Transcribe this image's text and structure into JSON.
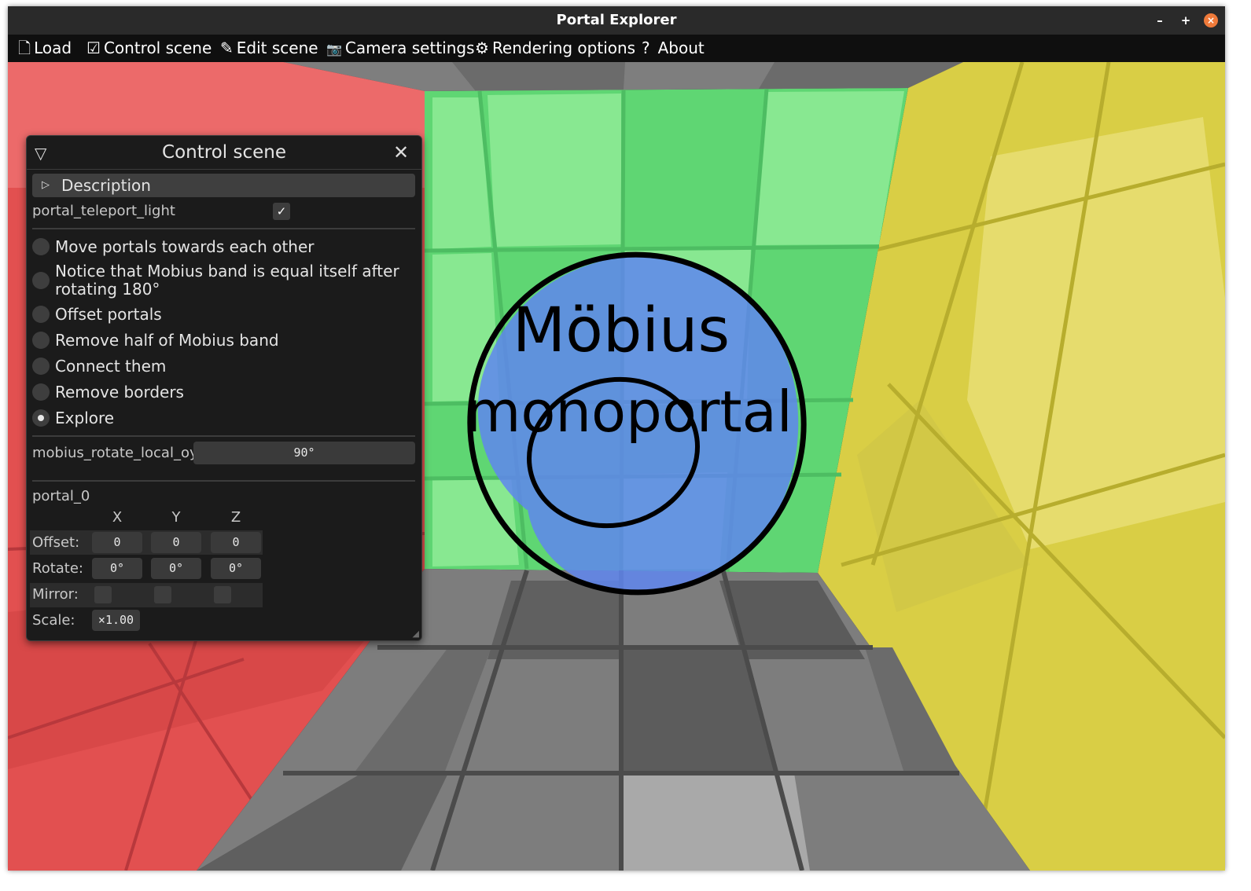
{
  "window": {
    "title": "Portal Explorer",
    "controls": {
      "minimize": "–",
      "maximize": "+",
      "close": "×"
    }
  },
  "menu": {
    "items": [
      {
        "icon": "file-icon",
        "glyph": "🗋",
        "label": "Load"
      },
      {
        "icon": "checkbox-icon",
        "glyph": "☑",
        "label": "Control scene"
      },
      {
        "icon": "pencil-icon",
        "glyph": "✎",
        "label": "Edit scene"
      },
      {
        "icon": "camera-icon",
        "glyph": "📷",
        "label": "Camera settings"
      },
      {
        "icon": "gear-icon",
        "glyph": "⚙",
        "label": "Rendering options"
      },
      {
        "icon": "question-icon",
        "glyph": "?",
        "label": "About"
      }
    ]
  },
  "scene": {
    "overlay_line1": "Möbius",
    "overlay_line2": "monoportal",
    "colors": {
      "red": "#e24a4a",
      "green": "#6fdc7e",
      "yellow": "#d6cd46",
      "grey": "#7a7a7a",
      "portal_blue": "#5f86ee"
    }
  },
  "panel": {
    "collapse_glyph": "▽",
    "title": "Control scene",
    "close_glyph": "✕",
    "description": {
      "glyph": "▷",
      "label": "Description"
    },
    "teleport_light": {
      "label": "portal_teleport_light",
      "checked": true,
      "check_glyph": "✓"
    },
    "steps": [
      {
        "lines": [
          "Move portals towards each other"
        ],
        "selected": false
      },
      {
        "lines": [
          "Notice that Mobius band is equal itself after",
          "rotating 180°"
        ],
        "selected": false
      },
      {
        "lines": [
          "Offset portals"
        ],
        "selected": false
      },
      {
        "lines": [
          "Remove half of Mobius band"
        ],
        "selected": false
      },
      {
        "lines": [
          "Connect them"
        ],
        "selected": false
      },
      {
        "lines": [
          "Remove borders"
        ],
        "selected": false
      },
      {
        "lines": [
          "Explore"
        ],
        "selected": true
      }
    ],
    "rotate": {
      "label": "mobius_rotate_local_oy",
      "value": "90°"
    },
    "portal": {
      "name": "portal_0",
      "columns": [
        "X",
        "Y",
        "Z"
      ],
      "offset": {
        "label": "Offset:",
        "values": [
          "0",
          "0",
          "0"
        ]
      },
      "rotate": {
        "label": "Rotate:",
        "values": [
          "0°",
          "0°",
          "0°"
        ]
      },
      "mirror": {
        "label": "Mirror:",
        "values": [
          false,
          false,
          false
        ]
      },
      "scale": {
        "label": "Scale:",
        "value": "×1.00"
      }
    }
  }
}
